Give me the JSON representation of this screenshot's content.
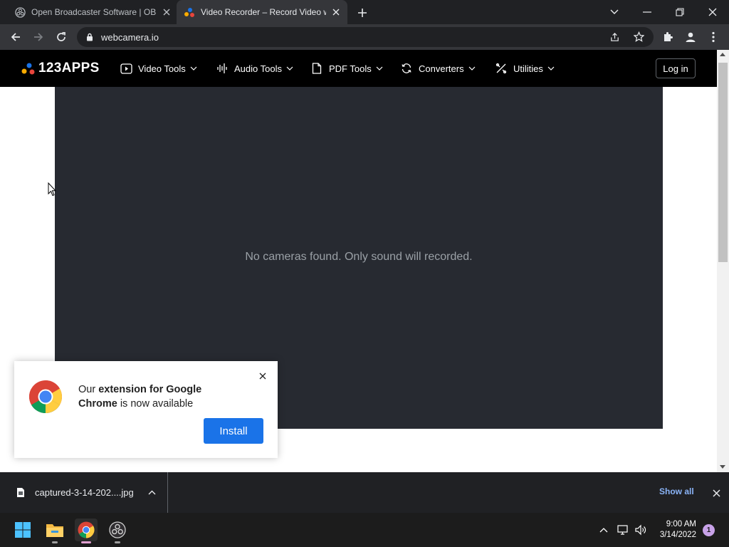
{
  "tabs": [
    {
      "title": "Open Broadcaster Software | OBS",
      "favicon": "obs-icon",
      "active": false
    },
    {
      "title": "Video Recorder – Record Video w",
      "favicon": "123apps-icon",
      "active": true
    }
  ],
  "toolbar": {
    "url": "webcamera.io"
  },
  "site": {
    "logo_text": "123APPS",
    "nav": [
      {
        "label": "Video Tools",
        "icon": "video-icon"
      },
      {
        "label": "Audio Tools",
        "icon": "audio-wave-icon"
      },
      {
        "label": "PDF Tools",
        "icon": "document-icon"
      },
      {
        "label": "Converters",
        "icon": "convert-icon"
      },
      {
        "label": "Utilities",
        "icon": "tools-icon"
      }
    ],
    "login_label": "Log in"
  },
  "recorder": {
    "message": "No cameras found. Only sound will recorded."
  },
  "popup": {
    "text_prefix": "Our ",
    "text_bold": "extension for Google Chrome",
    "text_suffix": " is now available",
    "install_label": "Install"
  },
  "downloads": {
    "filename": "captured-3-14-202....jpg",
    "show_all": "Show all"
  },
  "taskbar": {
    "time": "9:00 AM",
    "date": "3/14/2022",
    "notifications": "1"
  },
  "colors": {
    "accent": "#1a73e8",
    "recorder_bg": "#272a31",
    "nav_bg": "#000000"
  }
}
